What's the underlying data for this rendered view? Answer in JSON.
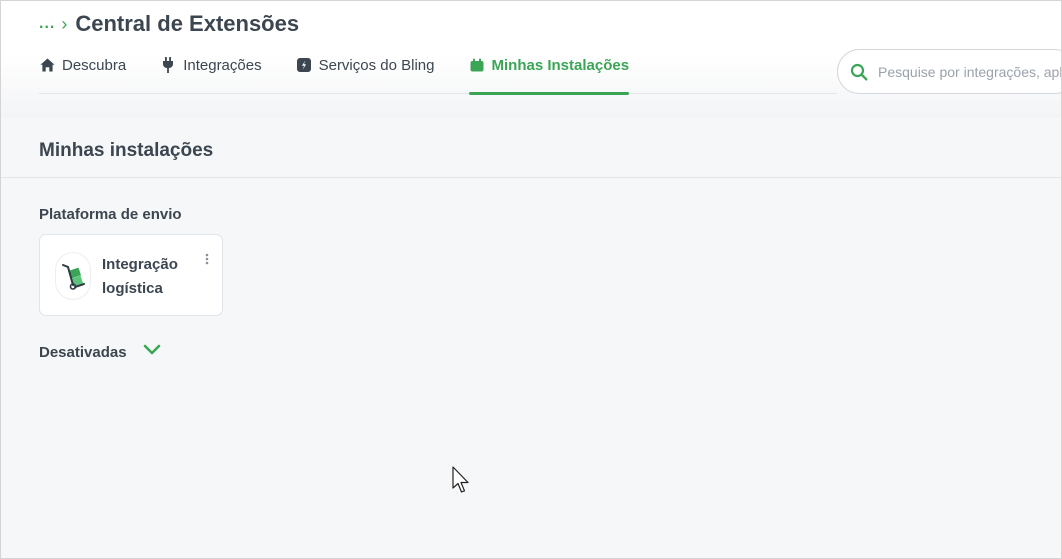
{
  "breadcrumb": {
    "ellipsis": "...",
    "separator": "›"
  },
  "header": {
    "title": "Central de Extensões"
  },
  "tabs": [
    {
      "label": "Descubra",
      "icon": "home-icon",
      "active": false
    },
    {
      "label": "Integrações",
      "icon": "plug-icon",
      "active": false
    },
    {
      "label": "Serviços do Bling",
      "icon": "bling-icon",
      "active": false
    },
    {
      "label": "Minhas Instalações",
      "icon": "box-icon",
      "active": true
    }
  ],
  "search": {
    "placeholder": "Pesquise por integrações, aplicativos"
  },
  "main": {
    "section_title": "Minhas instalações",
    "group_label": "Plataforma de envio",
    "card": {
      "name": "Integração logística",
      "logo": "hand-truck-icon",
      "menu_icon": "kebab-menu-icon"
    },
    "disabled_label": "Desativadas"
  },
  "colors": {
    "accent": "#3aa655",
    "text": "#3c4650",
    "background": "#f6f7f9"
  }
}
